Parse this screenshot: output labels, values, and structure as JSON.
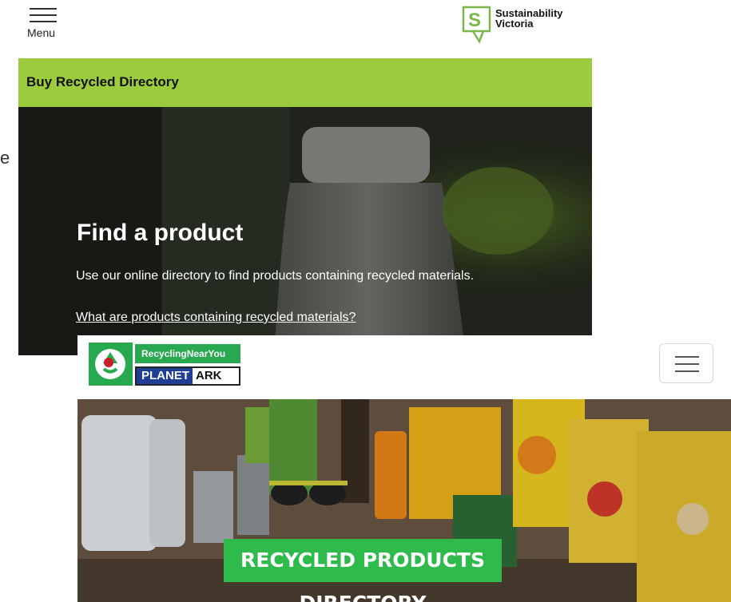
{
  "header": {
    "menu_label": "Menu",
    "logo_line1": "Sustainability",
    "logo_line2": "Victoria",
    "stray_text": "e"
  },
  "sv_page": {
    "band_title": "Buy Recycled Directory",
    "hero_title": "Find a product",
    "hero_subtitle": "Use our online directory to find products containing recycled materials.",
    "hero_link": "What are products containing recycled materials?"
  },
  "pa_page": {
    "logo_top": "RecyclingNearYou",
    "logo_part1": "PLANET",
    "logo_part2": "ARK",
    "banner_label": "RECYCLED PRODUCTS DIRECTORY"
  },
  "colors": {
    "band_green": "#9ccc3d",
    "sv_green": "#7ab648",
    "planet_ark_green": "#28a84f",
    "planet_ark_blue": "#1f3f96",
    "banner_green": "#2fbb4b"
  },
  "icons": {
    "menu": "hamburger-icon",
    "sv_mark": "speech-bubble-s-logo",
    "pa_mark": "recycle-bird-logo"
  }
}
